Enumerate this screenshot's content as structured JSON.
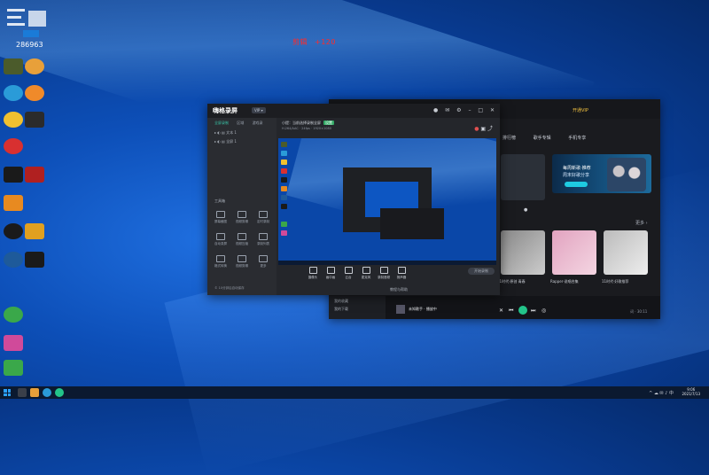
{
  "desktop": {
    "corner_id": "286963",
    "counter": {
      "label": "剪辑",
      "value": "+120"
    }
  },
  "rec_app": {
    "logo": "嗨格录屏",
    "badge": "VIP ▾",
    "left_tabs": [
      "全屏录制",
      "区域",
      "游戏录"
    ],
    "source_rows": [
      "文本 1",
      "全屏 1"
    ],
    "tools_title": "工具箱",
    "tools": [
      "屏幕截图",
      "视频剪辑",
      "定时录制",
      "自动录屏",
      "视频压缩",
      "录制列表",
      "格式转换",
      "视频剪辑",
      "更多"
    ],
    "hint": "小提：当前选择录制全屏",
    "hint_tag": "设置",
    "subhint": "H.264/AAC · 24fps · 1920×1080",
    "bottom_tools": [
      "摄像头",
      "画中画",
      "云台",
      "麦克风",
      "录制音频",
      "扬声器"
    ],
    "start_label": "开始录制",
    "status": "© 10分钟后自动保存",
    "footer_link": "教程与帮助"
  },
  "music_app": {
    "vip_label": "开通VIP",
    "tabs": [
      "排行榜",
      "歌手专辑",
      "手机专享"
    ],
    "banner": {
      "line1": "每周新歌·推荐",
      "line2": "周末好歌分享"
    },
    "more": "更多 ›",
    "captions": [
      "11时代·原创 青春",
      "11时代·好歌",
      "Rapper·说唱合集",
      "11时代·好歌推荐"
    ],
    "sidebar_bottom": [
      "我的收藏",
      "我的下载"
    ],
    "song": "未知歌手 · 播放中",
    "sb_label": "词 · 30:11"
  },
  "taskbar": {
    "time": "9:06",
    "date": "2021/7/13",
    "tray": "^ ☁ ✉ ♪ 中"
  }
}
